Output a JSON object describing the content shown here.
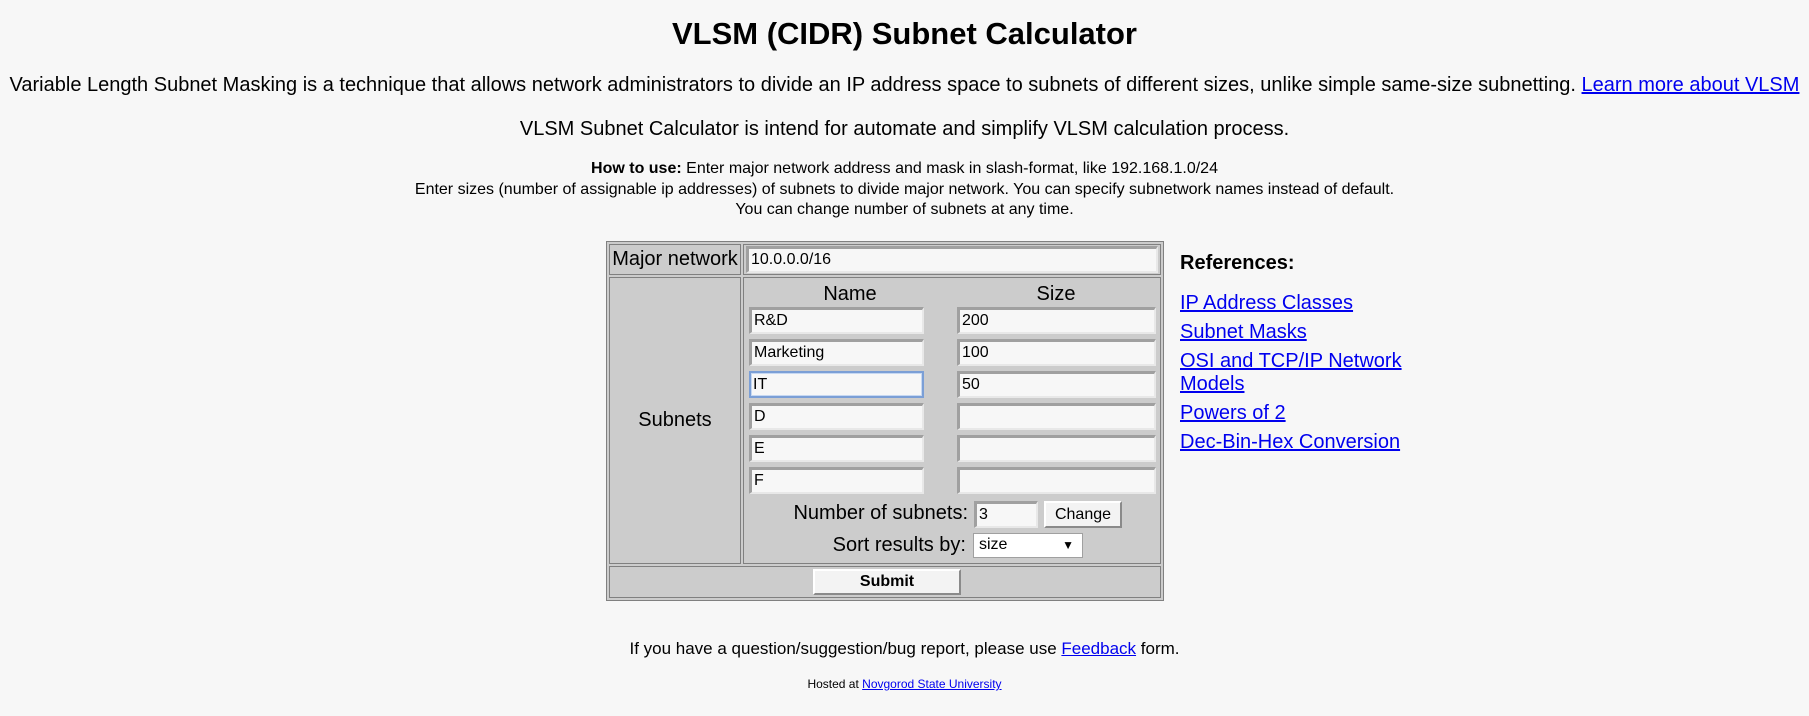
{
  "page": {
    "title": "VLSM (CIDR) Subnet Calculator",
    "intro": "Variable Length Subnet Masking is a technique that allows network administrators to divide an IP address space to subnets of different sizes, unlike simple same-size subnetting.",
    "learn_more": "Learn more about VLSM",
    "intro2": "VLSM Subnet Calculator is intend for automate and simplify VLSM calculation process.",
    "howto_bold": "How to use:",
    "howto_line1": "Enter major network address and mask in slash-format, like 192.168.1.0/24",
    "howto_line2": "Enter sizes (number of assignable ip addresses) of subnets to divide major network. You can specify subnetwork names instead of default.",
    "howto_line3": "You can change number of subnets at any time."
  },
  "form": {
    "major_label": "Major network",
    "major_value": "10.0.0.0/16",
    "subnets_label": "Subnets",
    "col_name": "Name",
    "col_size": "Size",
    "subnets": [
      {
        "name": "R&D",
        "size": "200"
      },
      {
        "name": "Marketing",
        "size": "100"
      },
      {
        "name": "IT",
        "size": "50"
      },
      {
        "name": "D",
        "size": ""
      },
      {
        "name": "E",
        "size": ""
      },
      {
        "name": "F",
        "size": ""
      }
    ],
    "focused_index": 2,
    "num_subnets_label": "Number of subnets:",
    "num_subnets_value": "3",
    "change_label": "Change",
    "sort_label": "Sort results by:",
    "sort_value": "size",
    "submit_label": "Submit"
  },
  "references": {
    "title": "References:",
    "links": [
      "IP Address Classes",
      "Subnet Masks",
      "OSI and TCP/IP Network Models",
      "Powers of 2",
      "Dec-Bin-Hex Conversion"
    ]
  },
  "footer": {
    "prefix": "If you have a question/suggestion/bug report, please use",
    "feedback": "Feedback",
    "suffix": "form.",
    "hosted_prefix": "Hosted at",
    "hosted_link": "Novgorod State University"
  },
  "colors": {
    "link": "#0000ee",
    "panel": "#cccccc",
    "background": "#f7f7f7"
  }
}
